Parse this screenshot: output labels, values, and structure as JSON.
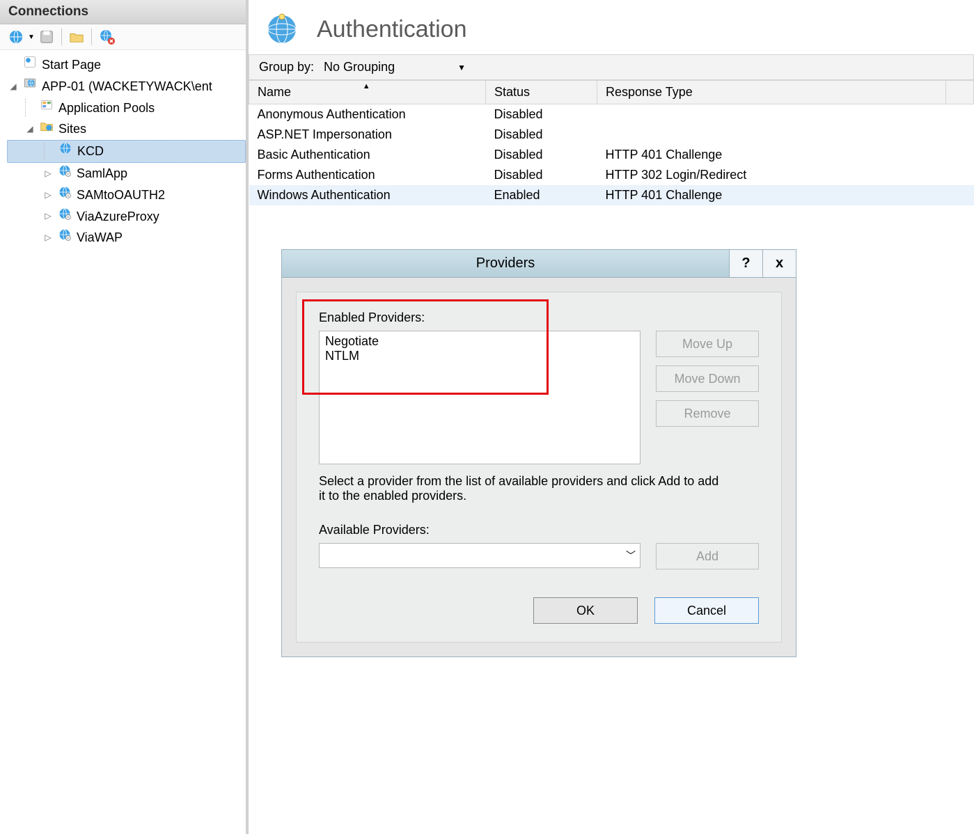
{
  "sidebar": {
    "title": "Connections",
    "tree": {
      "startPage": "Start Page",
      "server": "APP-01 (WACKETYWACK\\ent",
      "appPools": "Application Pools",
      "sites": "Sites",
      "siteItems": [
        "KCD",
        "SamlApp",
        "SAMtoOAUTH2",
        "ViaAzureProxy",
        "ViaWAP"
      ]
    }
  },
  "main": {
    "title": "Authentication",
    "groupByLabel": "Group by:",
    "groupByValue": "No Grouping",
    "columns": [
      "Name",
      "Status",
      "Response Type"
    ],
    "rows": [
      {
        "name": "Anonymous Authentication",
        "status": "Disabled",
        "response": ""
      },
      {
        "name": "ASP.NET Impersonation",
        "status": "Disabled",
        "response": ""
      },
      {
        "name": "Basic Authentication",
        "status": "Disabled",
        "response": "HTTP 401 Challenge"
      },
      {
        "name": "Forms Authentication",
        "status": "Disabled",
        "response": "HTTP 302 Login/Redirect"
      },
      {
        "name": "Windows Authentication",
        "status": "Enabled",
        "response": "HTTP 401 Challenge"
      }
    ]
  },
  "dialog": {
    "title": "Providers",
    "enabledLabel": "Enabled Providers:",
    "enabledItems": [
      "Negotiate",
      "NTLM"
    ],
    "buttons": {
      "moveUp": "Move Up",
      "moveDown": "Move Down",
      "remove": "Remove",
      "add": "Add",
      "ok": "OK",
      "cancel": "Cancel"
    },
    "infoText": "Select a provider from the list of available providers and click Add to add it to the enabled providers.",
    "availableLabel": "Available Providers:"
  }
}
